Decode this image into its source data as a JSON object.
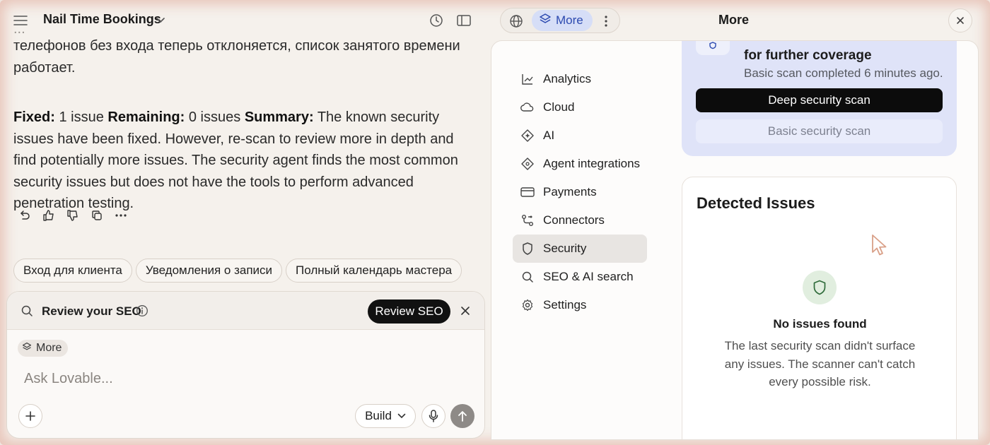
{
  "header": {
    "project_title": "Nail Time Bookings",
    "panel_title": "More",
    "mode_label": "More"
  },
  "chat": {
    "para1_clipped": "...",
    "para1_line2": "телефонов без входа теперь отклоняется, список занятого времени",
    "para1_line3": "работает.",
    "fixed_label": "Fixed:",
    "fixed_value": "1 issue",
    "remaining_label": "Remaining:",
    "remaining_value": "0 issues",
    "summary_label": "Summary:",
    "summary_text": "The known security issues have been fixed. However, re-scan to review more in depth and find potentially more issues. The security agent finds the most common security issues but does not have the tools to perform advanced penetration testing."
  },
  "suggestions": [
    "Вход для клиента",
    "Уведомления о записи",
    "Полный календарь мастера"
  ],
  "composer": {
    "seo_label": "Review your SEO",
    "seo_button": "Review SEO",
    "more_tag": "More",
    "placeholder": "Ask Lovable...",
    "build_label": "Build"
  },
  "nav": {
    "items": [
      {
        "label": "Analytics",
        "icon": "analytics-icon"
      },
      {
        "label": "Cloud",
        "icon": "cloud-icon"
      },
      {
        "label": "AI",
        "icon": "ai-icon"
      },
      {
        "label": "Agent integrations",
        "icon": "agent-icon"
      },
      {
        "label": "Payments",
        "icon": "card-icon"
      },
      {
        "label": "Connectors",
        "icon": "connectors-icon"
      },
      {
        "label": "Security",
        "icon": "shield-icon"
      },
      {
        "label": "SEO & AI search",
        "icon": "search-icon"
      },
      {
        "label": "Settings",
        "icon": "gear-icon"
      }
    ],
    "active": "Security"
  },
  "scan": {
    "title": "for further coverage",
    "subtitle": "Basic scan completed 6 minutes ago.",
    "deep_button": "Deep security scan",
    "basic_button": "Basic security scan"
  },
  "issues": {
    "title": "Detected Issues",
    "empty_title": "No issues found",
    "empty_desc": "The last security scan didn't surface any issues. The scanner can't catch every possible risk."
  },
  "colors": {
    "accent_blue": "#2c4ab0",
    "scan_card_bg": "#dfe3f8",
    "ok_green": "#2f6b3a"
  }
}
